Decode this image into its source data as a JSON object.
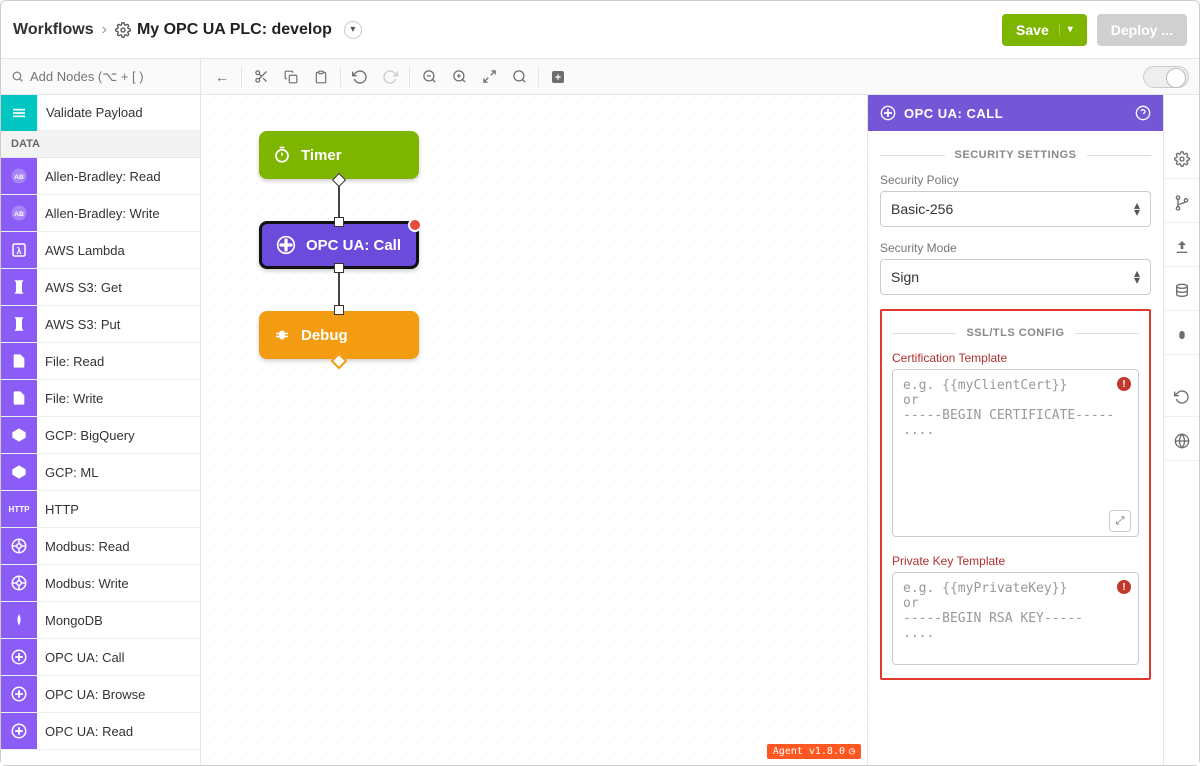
{
  "header": {
    "breadcrumb_root": "Workflows",
    "breadcrumb_title": "My OPC UA PLC: develop",
    "save_label": "Save",
    "deploy_label": "Deploy ..."
  },
  "toolbar": {
    "search_placeholder": "Add Nodes (⌥ + [ )"
  },
  "palette": {
    "top_item": "Validate Payload",
    "section": "DATA",
    "items": [
      {
        "label": "Allen-Bradley: Read",
        "icon": "AB"
      },
      {
        "label": "Allen-Bradley: Write",
        "icon": "AB"
      },
      {
        "label": "AWS Lambda",
        "icon": "λ"
      },
      {
        "label": "AWS S3: Get",
        "icon": "S3"
      },
      {
        "label": "AWS S3: Put",
        "icon": "S3"
      },
      {
        "label": "File: Read",
        "icon": "F"
      },
      {
        "label": "File: Write",
        "icon": "F"
      },
      {
        "label": "GCP: BigQuery",
        "icon": "BQ"
      },
      {
        "label": "GCP: ML",
        "icon": "ML"
      },
      {
        "label": "HTTP",
        "icon": "HTTP"
      },
      {
        "label": "Modbus: Read",
        "icon": "MB"
      },
      {
        "label": "Modbus: Write",
        "icon": "MB"
      },
      {
        "label": "MongoDB",
        "icon": "M"
      },
      {
        "label": "OPC UA: Call",
        "icon": "OPC"
      },
      {
        "label": "OPC UA: Browse",
        "icon": "OPC"
      },
      {
        "label": "OPC UA: Read",
        "icon": "OPC"
      }
    ]
  },
  "canvas": {
    "nodes": {
      "timer": "Timer",
      "opc": "OPC UA: Call",
      "debug": "Debug"
    },
    "agent_badge": "Agent v1.8.0"
  },
  "panel": {
    "title": "OPC UA: CALL",
    "security_heading": "SECURITY SETTINGS",
    "security_policy_label": "Security Policy",
    "security_policy_value": "Basic-256",
    "security_mode_label": "Security Mode",
    "security_mode_value": "Sign",
    "ssl_heading": "SSL/TLS CONFIG",
    "cert_label": "Certification Template",
    "cert_placeholder": "e.g. {{myClientCert}}\nor\n-----BEGIN CERTIFICATE-----\n....",
    "key_label": "Private Key Template",
    "key_placeholder": "e.g. {{myPrivateKey}}\nor\n-----BEGIN RSA KEY-----\n...."
  }
}
